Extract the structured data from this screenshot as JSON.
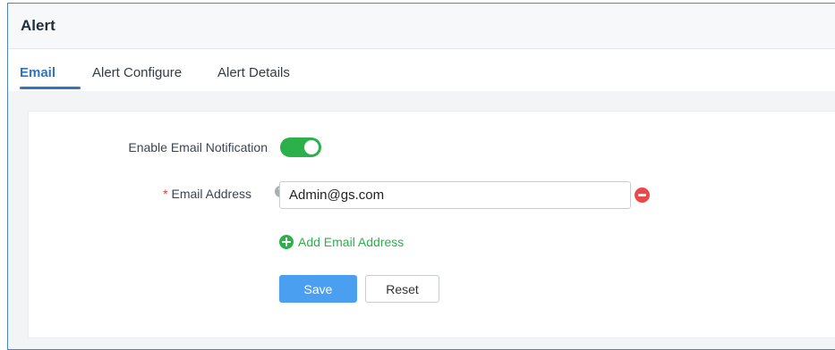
{
  "header": {
    "title": "Alert"
  },
  "tabs": [
    {
      "label": "Email",
      "active": true
    },
    {
      "label": "Alert Configure",
      "active": false
    },
    {
      "label": "Alert Details",
      "active": false
    }
  ],
  "form": {
    "enable_notification": {
      "label": "Enable Email Notification",
      "value": true
    },
    "email_address": {
      "required_mark": "*",
      "label": "Email Address",
      "help_icon": "question-circle-icon",
      "value": "Admin@gs.com",
      "remove_icon": "minus-circle-icon"
    },
    "add_email": {
      "icon": "plus-circle-icon",
      "label": "Add Email Address"
    },
    "buttons": {
      "save": "Save",
      "reset": "Reset"
    }
  },
  "colors": {
    "accent": "#2f73c6",
    "toggle_on": "#2bb04a",
    "add_green": "#2bb04a",
    "remove_red": "#e84a4a",
    "save_button": "#4a9ff1",
    "required": "#e0393e"
  }
}
